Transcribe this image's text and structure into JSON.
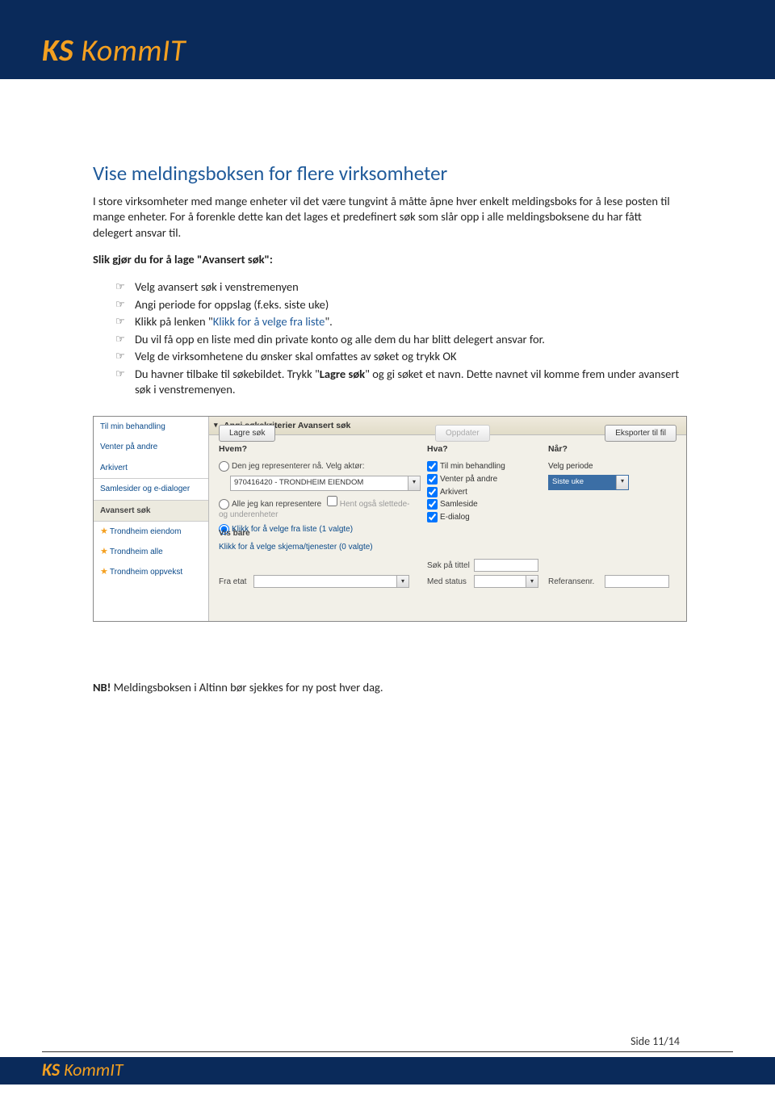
{
  "header": {
    "logo_prefix": "KS",
    "logo_rest": " KommIT"
  },
  "doc": {
    "title": "Vise meldingsboksen for flere virksomheter",
    "intro": "I store virksomheter med mange enheter vil det være tungvint å måtte åpne hver enkelt meldingsboks for å lese posten til mange enheter. For å forenkle dette kan det lages et predefinert søk som slår opp i alle meldingsboksene du har fått delegert ansvar til.",
    "howto_lead": "Slik gjør du for å lage \"Avansert søk\":",
    "bullets": [
      {
        "text": "Velg avansert søk i venstremenyen"
      },
      {
        "text": "Angi periode for oppslag (f.eks. siste uke)"
      },
      {
        "prefix": "Klikk på lenken \"",
        "link": "Klikk for å velge fra liste",
        "suffix": "\"."
      },
      {
        "text": "Du vil få opp en liste med din private konto og alle dem du har blitt delegert ansvar for."
      },
      {
        "text": "Velg de virksomhetene du ønsker skal omfattes av søket og trykk OK"
      },
      {
        "prefix": "Du havner tilbake til søkebildet. Trykk \"",
        "bold": "Lagre søk",
        "suffix": "\" og gi søket et navn. Dette navnet vil komme frem under avansert søk i venstremenyen."
      }
    ],
    "nb_prefix": "NB!",
    "nb_text": " Meldingsboksen i Altinn bør sjekkes for ny post hver dag."
  },
  "screenshot": {
    "sidebar": {
      "item1": "Til min behandling",
      "item2": "Venter på andre",
      "item3": "Arkivert",
      "item4": "Samlesider og e-dialoger",
      "header": "Avansert søk",
      "fav1": "Trondheim eiendom",
      "fav2": "Trondheim alle",
      "fav3": "Trondheim oppvekst"
    },
    "panel": {
      "title": "Angi søkekriterier Avansert søk",
      "who": "Hvem?",
      "radio1": "Den jeg representerer nå. Velg aktør:",
      "entity_value": "970416420 - TRONDHEIM EIENDOM",
      "radio2": "Alle jeg kan representere",
      "radio2_grey": "Hent også slettede- og underenheter",
      "radio3": "Klikk for å velge fra liste (1 valgte)",
      "what": "Hva?",
      "chk1": "Til min behandling",
      "chk2": "Venter på andre",
      "chk3": "Arkivert",
      "chk4": "Samleside",
      "chk5": "E-dialog",
      "when": "Når?",
      "period_label": "Velg periode",
      "period_value": "Siste uke",
      "visbare": "Vis bare",
      "visbare_link": "Klikk for å velge skjema/tjenester (0 valgte)",
      "sok_tittel": "Søk på tittel",
      "fra_etat": "Fra etat",
      "med_status": "Med status",
      "referansenr": "Referansenr.",
      "btn_save": "Lagre søk",
      "btn_update": "Oppdater",
      "btn_export": "Eksporter til fil"
    }
  },
  "footer": {
    "page": "Side 11/14"
  }
}
